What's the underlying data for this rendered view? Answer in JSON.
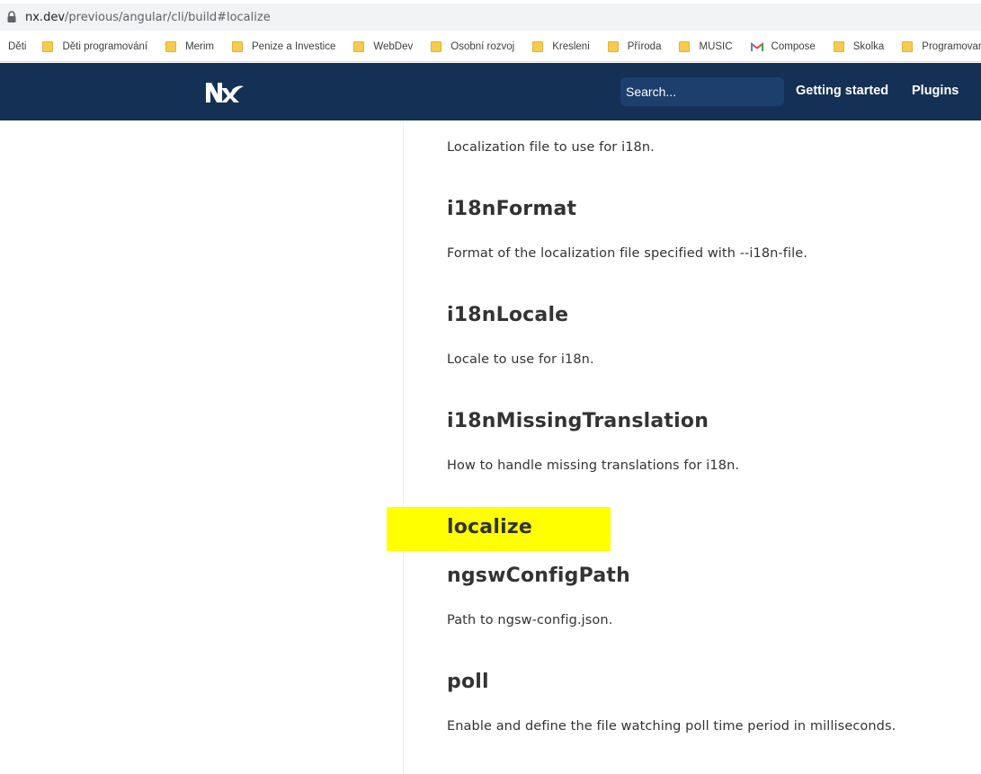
{
  "browser": {
    "url_host": "nx.dev",
    "url_path": "/previous/angular/cli/build#localize",
    "bookmarks": [
      {
        "label": "Děti",
        "type": "text"
      },
      {
        "label": "Děti programování",
        "type": "folder"
      },
      {
        "label": "Merim",
        "type": "folder"
      },
      {
        "label": "Penize a Investice",
        "type": "folder"
      },
      {
        "label": "WebDev",
        "type": "folder"
      },
      {
        "label": "Osobní rozvoj",
        "type": "folder"
      },
      {
        "label": "Kresleni",
        "type": "folder"
      },
      {
        "label": "Příroda",
        "type": "folder"
      },
      {
        "label": "MUSIC",
        "type": "folder"
      },
      {
        "label": "Compose",
        "type": "gmail"
      },
      {
        "label": "Skolka",
        "type": "folder"
      },
      {
        "label": "Programovar",
        "type": "folder"
      }
    ]
  },
  "header": {
    "logo_icon": "nx-logo-icon",
    "search_placeholder": "Search...",
    "nav": {
      "getting_started": "Getting started",
      "plugins": "Plugins"
    },
    "colors": {
      "background": "#143055",
      "search_bg": "#1c3f6e"
    }
  },
  "content": {
    "intro_desc": "Localization file to use for i18n.",
    "options": [
      {
        "name": "i18nFormat",
        "description": "Format of the localization file specified with --i18n-file."
      },
      {
        "name": "i18nLocale",
        "description": "Locale to use for i18n."
      },
      {
        "name": "i18nMissingTranslation",
        "description": "How to handle missing translations for i18n."
      },
      {
        "name": "localize",
        "description": ""
      },
      {
        "name": "ngswConfigPath",
        "description": "Path to ngsw-config.json."
      },
      {
        "name": "poll",
        "description": "Enable and define the file watching poll time period in milliseconds."
      }
    ],
    "highlight_color": "#ffff00"
  }
}
